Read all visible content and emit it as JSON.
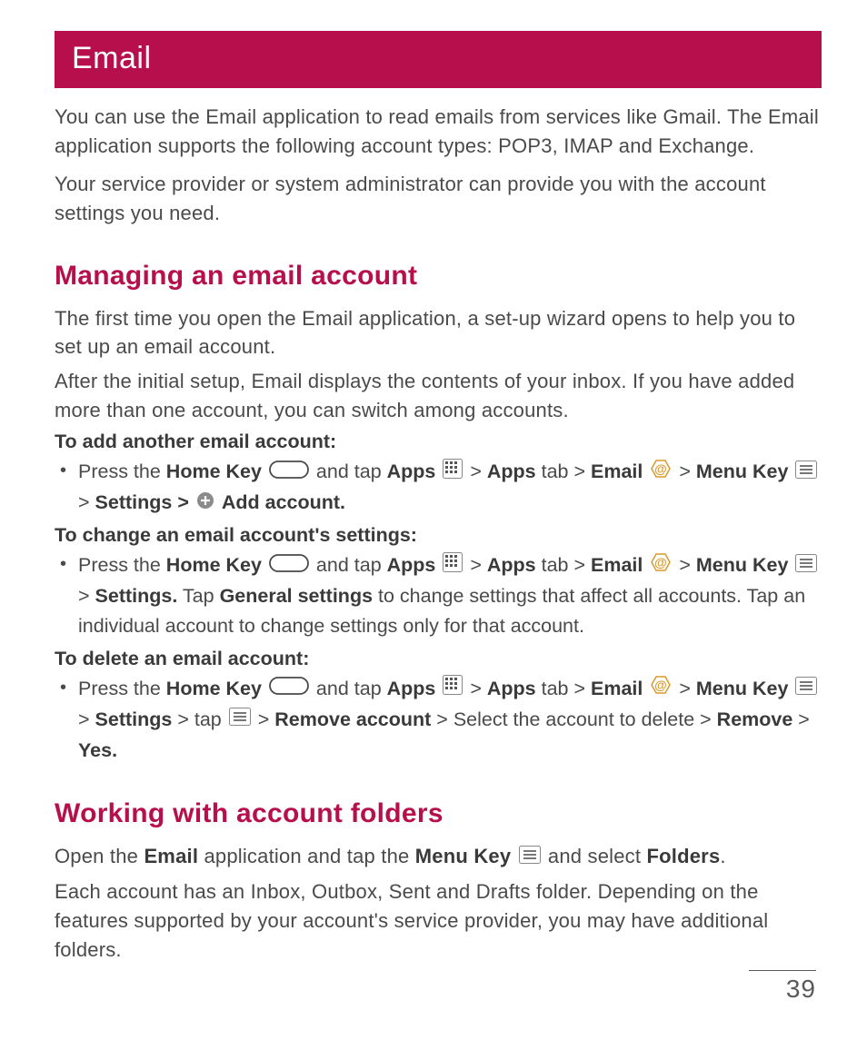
{
  "title": "Email",
  "intro_p1": "You can use the Email application to read emails from services like Gmail. The Email application supports the following account types: POP3, IMAP and Exchange.",
  "intro_p2": "Your service provider or system administrator can provide you with the account settings you need.",
  "section1": {
    "heading": "Managing an email account",
    "p1": "The first time you open the Email application, a set-up wizard opens to help you to set up an email account.",
    "p2": "After the initial setup, Email displays the contents of your inbox. If you have added more than one account, you can switch among accounts.",
    "sub1": "To add another email account:",
    "bullet1": {
      "press_the": "Press the ",
      "home_key": "Home Key",
      "and_tap": " and tap ",
      "apps": "Apps",
      "gt": " > ",
      "apps_bold": "Apps",
      "apps_tab": " tab > ",
      "email": "Email",
      "menu_key": "Menu Key",
      "settings_gt": "Settings > ",
      "add_account": " Add account."
    },
    "sub2": "To change an email account's settings:",
    "bullet2": {
      "press_the": "Press the ",
      "home_key": "Home Key",
      "and_tap": " and tap ",
      "apps": "Apps",
      "gt": " > ",
      "apps_bold": "Apps",
      "apps_tab": " tab > ",
      "email": "Email",
      "menu_key": "Menu Key",
      "settings_dot": "Settings.",
      "tap": " Tap ",
      "general_settings": "General settings",
      "rest": " to change settings that affect all accounts. Tap an individual account to change settings only for that account."
    },
    "sub3": "To delete an email account:",
    "bullet3": {
      "press_the": "Press the ",
      "home_key": "Home Key",
      "and_tap": " and tap ",
      "apps": "Apps",
      "gt": " > ",
      "apps_bold": "Apps",
      "apps_tab": " tab > ",
      "email": "Email",
      "menu_key": "Menu Key",
      "settings": "Settings",
      "tap_gt": " > tap ",
      "remove_account": "Remove account",
      "select_text": " > Select the account to delete > ",
      "remove": "Remove",
      "yes": "Yes."
    }
  },
  "section2": {
    "heading": "Working with account folders",
    "p1_a": "Open the ",
    "p1_email": "Email",
    "p1_b": " application and tap the ",
    "p1_menu_key": "Menu Key",
    "p1_c": " and select ",
    "p1_folders": "Folders",
    "p1_d": ".",
    "p2": "Each account has an Inbox, Outbox, Sent and Drafts folder. Depending on the features supported by your account's service provider, you may have additional folders."
  },
  "page_number": "39"
}
